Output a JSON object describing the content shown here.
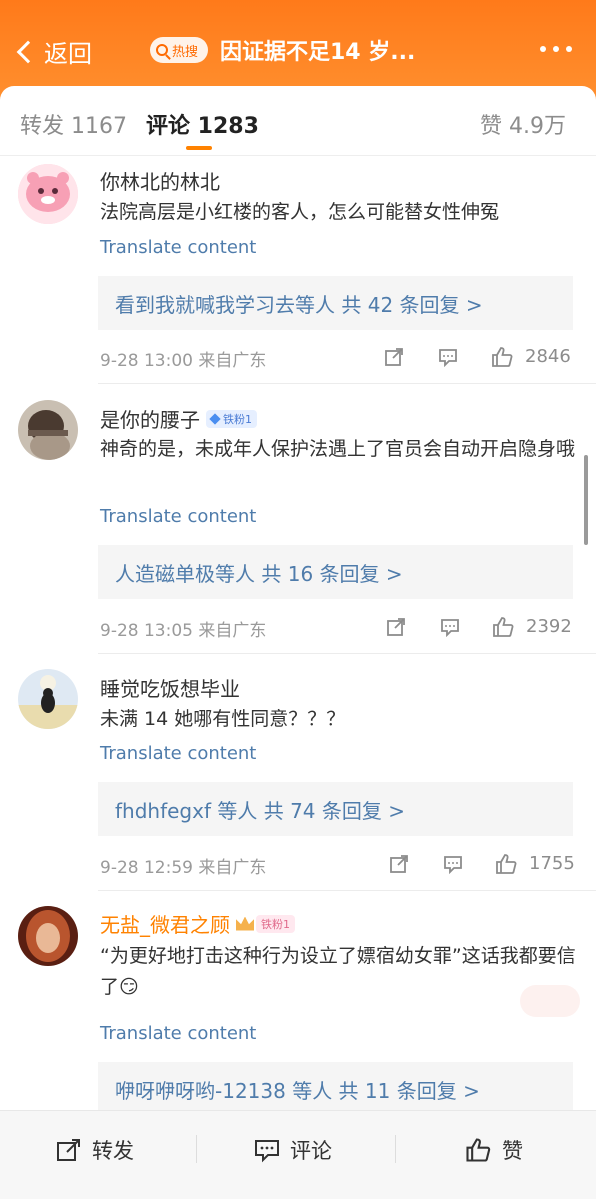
{
  "header": {
    "back_label": "返回",
    "hot_label": "热搜",
    "title": "因证据不足14 岁...",
    "more_icon": "more-dots-icon"
  },
  "tabs": [
    {
      "label": "转发 1167"
    },
    {
      "label": "评论 1283"
    },
    {
      "label": "赞 4.9万"
    }
  ],
  "colors": {
    "header_orange": "#ff8200",
    "link_blue": "#4f7cab",
    "name_orange": "#ff8200"
  },
  "comments": [
    {
      "username": "你林北的林北",
      "text": "法院高层是小红楼的客人，怎么可能替女性伸冤",
      "translate": "Translate content",
      "replies": "看到我就喊我学习去等人  共 42 条回复 >",
      "meta": "9-28 13:00  来自广东",
      "likes": "2846"
    },
    {
      "username": "是你的腰子",
      "badge": "铁粉1",
      "text": "神奇的是，未成年人保护法遇上了官员会自动开启隐身哦",
      "translate": "Translate content",
      "replies": "人造磁单极等人  共 16 条回复 >",
      "meta": "9-28 13:05  来自广东",
      "likes": "2392"
    },
    {
      "username": "睡觉吃饭想毕业",
      "text": "未满 14 她哪有性同意？？？",
      "translate": "Translate content",
      "replies": "fhdhfegxf 等人  共 74 条回复 >",
      "meta": "9-28 12:59  来自广东",
      "likes": "1755"
    },
    {
      "username": "无盐_微君之顾",
      "badge": "铁粉1",
      "text": "“为更好地打击这种行为设立了嫖宿幼女罪”这话我都要信了😏",
      "translate": "Translate content",
      "replies": "咿呀咿呀哟-12138 等人  共 11 条回复 >"
    }
  ],
  "bottom_bar": {
    "repost": "转发",
    "comment": "评论",
    "like": "赞"
  }
}
